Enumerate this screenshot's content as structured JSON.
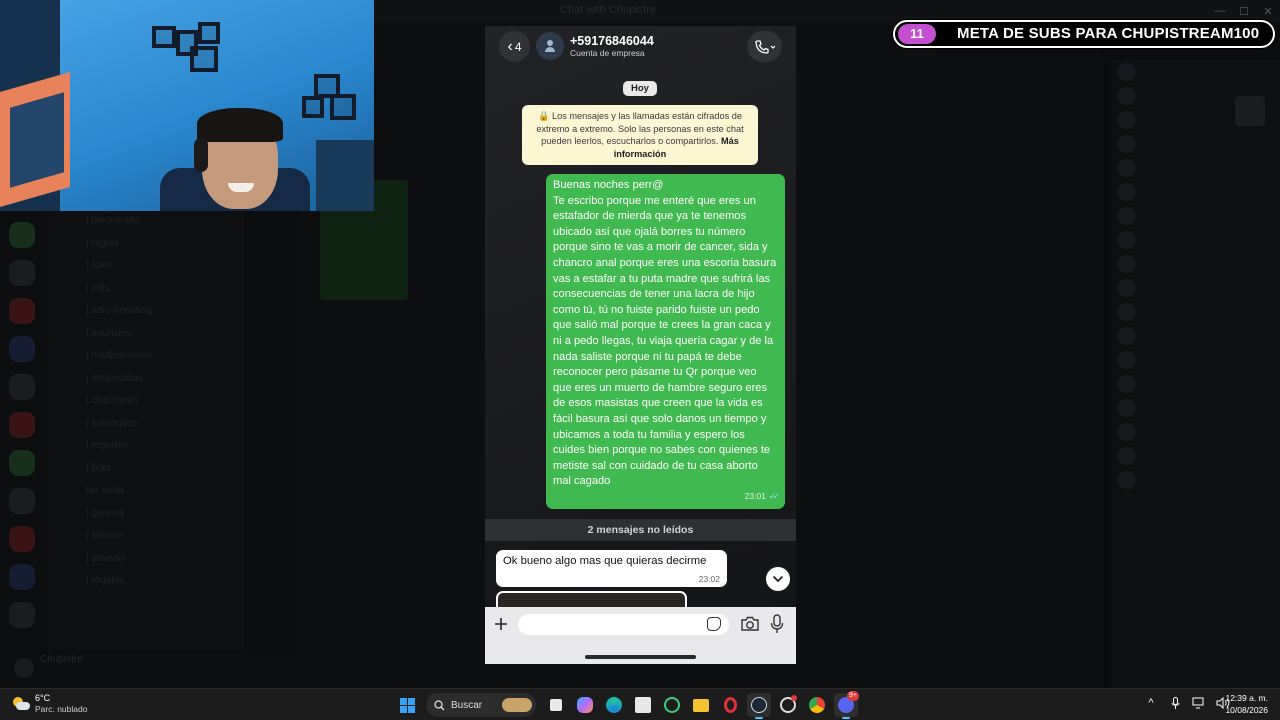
{
  "background": {
    "window_title": "Chat with Chupistre",
    "channels": [
      "| bienvenido",
      "| reglas",
      "| roles",
      "| rolls",
      "| nitro-boosting",
      "| anuncios",
      "| notificaciones",
      "| despedidas",
      "| chat-mods",
      "| comandos",
      "| reportes",
      "| links",
      "las salas",
      "| general",
      "| chisme",
      "| privado",
      "| regalos"
    ],
    "user": "Chupistre"
  },
  "phone": {
    "back_count": "4",
    "contact_number": "+59176846044",
    "contact_type": "Cuenta de empresa",
    "date_chip": "Hoy",
    "encryption_notice": "🔒 Los mensajes y las llamadas están cifrados de extremo a extremo. Solo las personas en este chat pueden leerlos, escucharlos o compartirlos.",
    "encryption_link": "Más información",
    "outgoing_message": "Buenas noches perr@\nTe escribo porque me enteré que eres un estafador de mierda que ya te tenemos ubicado así que ojalá borres tu número porque sino te vas a morir de cancer, sida y chancro anal porque eres una escoria basura vas a estafar a tu puta madre que sufrirá las consecuencias de tener una lacra de hijo como tú, tú no fuiste parido fuiste un pedo que salió mal porque te crees la gran caca y ni a pedo llegas, tu viaja quería cagar y de la nada saliste porque ni tu papá te debe reconocer pero pásame tu Qr porque veo que eres un muerto de hambre seguro eres de esos masistas que creen que la vida es fácil basura así que solo danos un tiempo y ubicamos a toda tu familia y espero los cuides bien porque no sabes con quienes te metiste sal con cuidado de tu casa aborto mal cagado",
    "outgoing_time": "23:01",
    "unread_banner": "2 mensajes no leídos",
    "incoming_message": "Ok bueno algo mas que quieras decirme",
    "incoming_time": "23:02",
    "composer_placeholder": ""
  },
  "sub_goal": {
    "count": "11",
    "text": "META DE SUBS PARA CHUPISTREAM100",
    "badge_color": "#c44fd1"
  },
  "taskbar": {
    "weather_temp": "6°C",
    "weather_condition": "Parc. nublado",
    "search_label": "Buscar",
    "time": "12:39 a. m.",
    "date": "10/08/2026",
    "discord_badge": "9+"
  }
}
